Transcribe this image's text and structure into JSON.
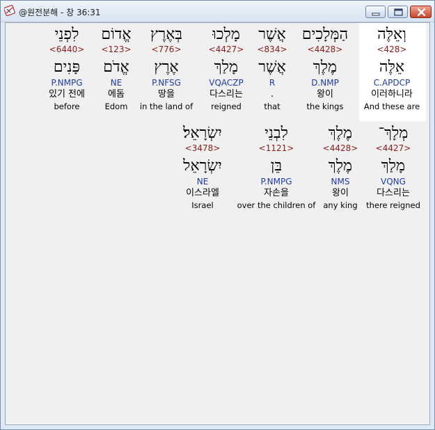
{
  "window": {
    "title": "@원전분해 - 창 36:31"
  },
  "icons": {
    "app": "hebrew-bible-app-icon",
    "minimize": "minimize-icon",
    "maximize": "maximize-icon",
    "close": "close-icon"
  },
  "colors": {
    "strong_number": "#8b1a1a",
    "morphology": "#1f3aa8",
    "selected_word_background": "#ffffff"
  },
  "rows": [
    {
      "words": [
        {
          "hebrew": "וְאֵלֶּה",
          "strong": "<428>",
          "lemma": "אֵלֶּה",
          "morph": "C.APDCP",
          "korean": "이러하니라",
          "english": "And these are",
          "selected": true
        },
        {
          "hebrew": "הַמְּלָכִים",
          "strong": "<4428>",
          "lemma": "מֶלֶךְ",
          "morph": "D.NMP",
          "korean": "왕이",
          "english": "the kings"
        },
        {
          "hebrew": "אֲשֶׁר",
          "strong": "<834>",
          "lemma": "אֲשֶׁר",
          "morph": "R",
          "korean": ".",
          "english": "that"
        },
        {
          "hebrew": "מָלְכוּ",
          "strong": "<4427>",
          "lemma": "מָלַךְ",
          "morph": "VQACZP",
          "korean": "다스리는",
          "english": "reigned"
        },
        {
          "hebrew": "בְּאֶרֶץ",
          "strong": "<776>",
          "lemma": "אֶרֶץ",
          "morph": "P.NFSG",
          "korean": "땅을",
          "english": "in the land of"
        },
        {
          "hebrew": "אֱדוֹם",
          "strong": "<123>",
          "lemma": "אֱדֹם",
          "morph": "NE",
          "korean": "에돔",
          "english": "Edom"
        },
        {
          "hebrew": "לִפְנֵי",
          "strong": "<6440>",
          "lemma": "פָּנִים",
          "morph": "P.NMPG",
          "korean": "있기 전에",
          "english": "before"
        }
      ]
    },
    {
      "words": [
        {
          "hebrew": "מְלָךְ־",
          "strong": "<4427>",
          "lemma": "מָלַךְ",
          "morph": "VQNG",
          "korean": "다스리는",
          "english": "there reigned"
        },
        {
          "hebrew": "מֶלֶךְ",
          "strong": "<4428>",
          "lemma": "מֶלֶךְ",
          "morph": "NMS",
          "korean": "왕이",
          "english": "any king"
        },
        {
          "hebrew": "לִבְנֵי",
          "strong": "<1121>",
          "lemma": "בֵּן",
          "morph": "P.NMPG",
          "korean": "자손을",
          "english": "over the children of"
        },
        {
          "hebrew": "יִשְׂרָאֵל׃",
          "strong": "<3478>",
          "lemma": "יִשְׂרָאֵל",
          "morph": "NE",
          "korean": "이스라엘",
          "english": "Israel"
        }
      ]
    }
  ]
}
